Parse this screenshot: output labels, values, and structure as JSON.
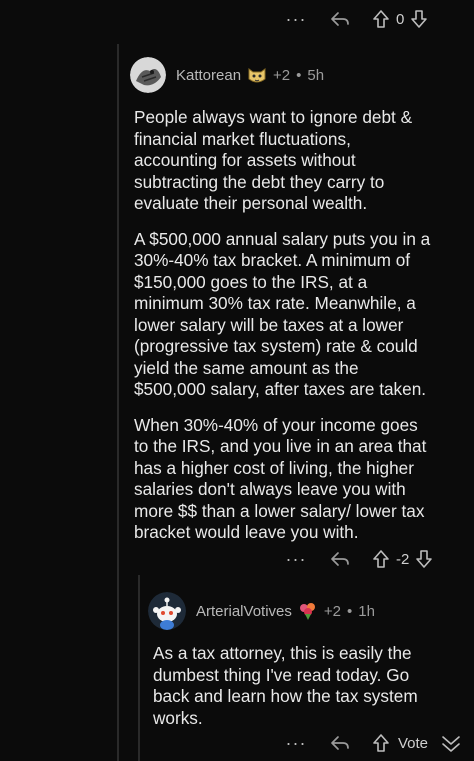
{
  "top_row": {
    "score": "0"
  },
  "comment1": {
    "username": "Kattorean",
    "badge_icon": "cat-face-icon",
    "karma": "+2",
    "separator": "•",
    "age": "5h",
    "paragraphs": [
      "People always want to ignore debt &\nfinancial market fluctuations,\naccounting for assets without\nsubtracting the debt they carry to\nevaluate their personal wealth.",
      "A $500,000 annual salary puts you in a\n30%-40% tax bracket.  A minimum of\n$150,000 goes to the IRS, at a\nminimum 30% tax rate.   Meanwhile, a\nlower salary will be taxes at a lower\n(progressive tax system)  rate & could\nyield the same amount as the\n$500,000 salary, after taxes are taken.",
      "When 30%-40% of your income goes\nto the IRS, and you live in an area that\nhas a higher cost of living,  the higher\nsalaries don't always leave you with\nmore $$ than a lower salary/ lower tax\nbracket would leave you with."
    ],
    "score": "-2"
  },
  "comment2": {
    "username": "ArterialVotives",
    "badge_icon": "flower-bouquet-icon",
    "karma": "+2",
    "separator": "•",
    "age": "1h",
    "paragraphs": [
      "As a tax attorney, this is easily the\ndumbest thing I've read today. Go\nback and learn how the tax system\nworks."
    ],
    "vote_label": "Vote"
  },
  "colors": {
    "background": "#0b0b0b",
    "text": "#e9e9e9",
    "muted": "#9b9b9b",
    "thread_line": "#2a2a2a"
  }
}
